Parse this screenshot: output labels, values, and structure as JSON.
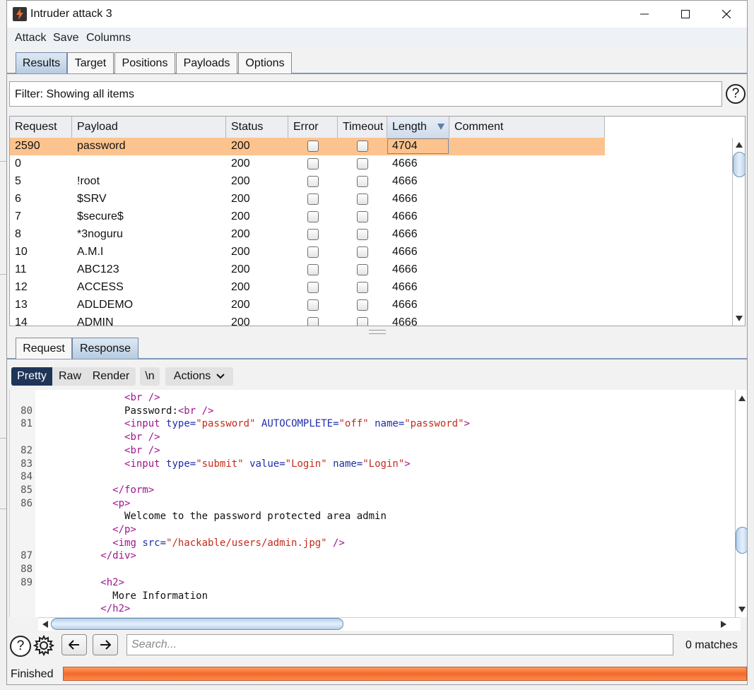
{
  "window": {
    "title": "Intruder attack 3"
  },
  "menu": [
    "Attack",
    "Save",
    "Columns"
  ],
  "top_tabs": [
    {
      "label": "Results",
      "active": true
    },
    {
      "label": "Target",
      "active": false
    },
    {
      "label": "Positions",
      "active": false
    },
    {
      "label": "Payloads",
      "active": false
    },
    {
      "label": "Options",
      "active": false
    }
  ],
  "filter": {
    "text": "Filter: Showing all items"
  },
  "table": {
    "columns": [
      "Request",
      "Payload",
      "Status",
      "Error",
      "Timeout",
      "Length",
      "Comment"
    ],
    "sorted_column": "Length",
    "rows": [
      {
        "request": "2590",
        "payload": "password",
        "status": "200",
        "length": "4704",
        "selected": true
      },
      {
        "request": "0",
        "payload": "",
        "status": "200",
        "length": "4666"
      },
      {
        "request": "5",
        "payload": "!root",
        "status": "200",
        "length": "4666"
      },
      {
        "request": "6",
        "payload": "$SRV",
        "status": "200",
        "length": "4666"
      },
      {
        "request": "7",
        "payload": "$secure$",
        "status": "200",
        "length": "4666"
      },
      {
        "request": "8",
        "payload": "*3noguru",
        "status": "200",
        "length": "4666"
      },
      {
        "request": "10",
        "payload": "A.M.I",
        "status": "200",
        "length": "4666"
      },
      {
        "request": "11",
        "payload": "ABC123",
        "status": "200",
        "length": "4666"
      },
      {
        "request": "12",
        "payload": "ACCESS",
        "status": "200",
        "length": "4666"
      },
      {
        "request": "13",
        "payload": "ADLDEMO",
        "status": "200",
        "length": "4666"
      },
      {
        "request": "14",
        "payload": "ADMIN",
        "status": "200",
        "length": "4666"
      }
    ]
  },
  "mid_tabs": [
    {
      "label": "Request",
      "active": false
    },
    {
      "label": "Response",
      "active": true
    }
  ],
  "toolbar": {
    "pretty": "Pretty",
    "raw": "Raw",
    "render": "Render",
    "newline": "\\n",
    "actions": "Actions"
  },
  "code_lines": [
    {
      "ln": "",
      "indent": 14,
      "tokens": [
        [
          "tag",
          "<br />"
        ]
      ]
    },
    {
      "ln": "80",
      "indent": 14,
      "tokens": [
        [
          "txt",
          "Password:"
        ],
        [
          "tag",
          "<br />"
        ]
      ]
    },
    {
      "ln": "81",
      "indent": 14,
      "tokens": [
        [
          "tag",
          "<input "
        ],
        [
          "attr",
          "type="
        ],
        [
          "val",
          "\"password\""
        ],
        [
          "txt",
          " "
        ],
        [
          "attr",
          "AUTOCOMPLETE="
        ],
        [
          "val",
          "\"off\""
        ],
        [
          "txt",
          " "
        ],
        [
          "attr",
          "name="
        ],
        [
          "val",
          "\"password\""
        ],
        [
          "tag",
          ">"
        ]
      ]
    },
    {
      "ln": "",
      "indent": 14,
      "tokens": [
        [
          "tag",
          "<br />"
        ]
      ]
    },
    {
      "ln": "82",
      "indent": 14,
      "tokens": [
        [
          "tag",
          "<br />"
        ]
      ]
    },
    {
      "ln": "83",
      "indent": 14,
      "tokens": [
        [
          "tag",
          "<input "
        ],
        [
          "attr",
          "type="
        ],
        [
          "val",
          "\"submit\""
        ],
        [
          "txt",
          " "
        ],
        [
          "attr",
          "value="
        ],
        [
          "val",
          "\"Login\""
        ],
        [
          "txt",
          " "
        ],
        [
          "attr",
          "name="
        ],
        [
          "val",
          "\"Login\""
        ],
        [
          "tag",
          ">"
        ]
      ]
    },
    {
      "ln": "84",
      "indent": 0,
      "tokens": []
    },
    {
      "ln": "85",
      "indent": 12,
      "tokens": [
        [
          "tag",
          "</form>"
        ]
      ]
    },
    {
      "ln": "86",
      "indent": 12,
      "tokens": [
        [
          "tag",
          "<p>"
        ]
      ]
    },
    {
      "ln": "",
      "indent": 14,
      "tokens": [
        [
          "txt",
          "Welcome to the password protected area admin"
        ]
      ]
    },
    {
      "ln": "",
      "indent": 12,
      "tokens": [
        [
          "tag",
          "</p>"
        ]
      ]
    },
    {
      "ln": "",
      "indent": 12,
      "tokens": [
        [
          "tag",
          "<img "
        ],
        [
          "attr",
          "src="
        ],
        [
          "val",
          "\"/hackable/users/admin.jpg\""
        ],
        [
          "txt",
          " "
        ],
        [
          "tag",
          "/>"
        ]
      ]
    },
    {
      "ln": "87",
      "indent": 10,
      "tokens": [
        [
          "tag",
          "</div>"
        ]
      ]
    },
    {
      "ln": "88",
      "indent": 0,
      "tokens": []
    },
    {
      "ln": "89",
      "indent": 10,
      "tokens": [
        [
          "tag",
          "<h2>"
        ]
      ]
    },
    {
      "ln": "",
      "indent": 12,
      "tokens": [
        [
          "txt",
          "More Information"
        ]
      ]
    },
    {
      "ln": "",
      "indent": 10,
      "tokens": [
        [
          "tag",
          "</h2>"
        ]
      ]
    }
  ],
  "search": {
    "placeholder": "Search...",
    "matches": "0 matches"
  },
  "status": {
    "text": "Finished",
    "progress": 1.0
  },
  "colors": {
    "selected_row": "#fcc38e",
    "progress": "#f06a2b",
    "active_toolbar": "#1e3558"
  },
  "icons": [
    "help-icon",
    "gear-icon",
    "back-arrow-icon",
    "forward-arrow-icon",
    "minimize-icon",
    "maximize-icon",
    "close-icon"
  ]
}
